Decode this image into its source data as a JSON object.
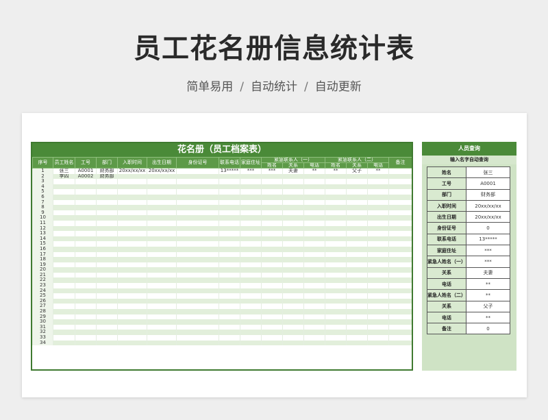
{
  "page": {
    "title": "员工花名册信息统计表",
    "subtitle": [
      "简单易用",
      "自动统计",
      "自动更新"
    ],
    "separator": "/"
  },
  "roster": {
    "title": "花名册（员工档案表）",
    "group1": "紧急联系人（一）",
    "group2": "紧急联系人（二）",
    "headers": [
      "序号",
      "员工姓名",
      "工号",
      "部门",
      "入职时间",
      "出生日期",
      "身份证号",
      "联系电话",
      "家庭住址"
    ],
    "sub_headers": [
      "姓名",
      "关系",
      "电话",
      "姓名",
      "关系",
      "电话"
    ],
    "last_header": "备注",
    "rows": [
      [
        "1",
        "张三",
        "A0001",
        "财务部",
        "20xx/xx/xx",
        "20xx/xx/xx",
        "",
        "13*****",
        "***",
        "***",
        "夫妻",
        "**",
        "**",
        "父子",
        "**",
        ""
      ],
      [
        "2",
        "李四",
        "A0002",
        "财务部",
        "",
        "",
        "",
        "",
        "",
        "",
        "",
        "",
        "",
        "",
        "",
        ""
      ]
    ],
    "row_count": 34
  },
  "lookup": {
    "title": "人员查询",
    "subtitle": "输入名字自动查询",
    "fields": [
      {
        "k": "姓名",
        "v": "张三"
      },
      {
        "k": "工号",
        "v": "A0001"
      },
      {
        "k": "部门",
        "v": "财务部"
      },
      {
        "k": "入职时间",
        "v": "20xx/xx/xx"
      },
      {
        "k": "出生日期",
        "v": "20xx/xx/xx"
      },
      {
        "k": "身份证号",
        "v": "0"
      },
      {
        "k": "联系电话",
        "v": "13*****"
      },
      {
        "k": "家庭住址",
        "v": "***"
      },
      {
        "k": "紧急人姓名（一）",
        "v": "***"
      },
      {
        "k": "关系",
        "v": "夫妻"
      },
      {
        "k": "电话",
        "v": "**"
      },
      {
        "k": "紧急人姓名（二）",
        "v": "**"
      },
      {
        "k": "关系",
        "v": "父子"
      },
      {
        "k": "电话",
        "v": "**"
      },
      {
        "k": "备注",
        "v": "0"
      }
    ]
  }
}
